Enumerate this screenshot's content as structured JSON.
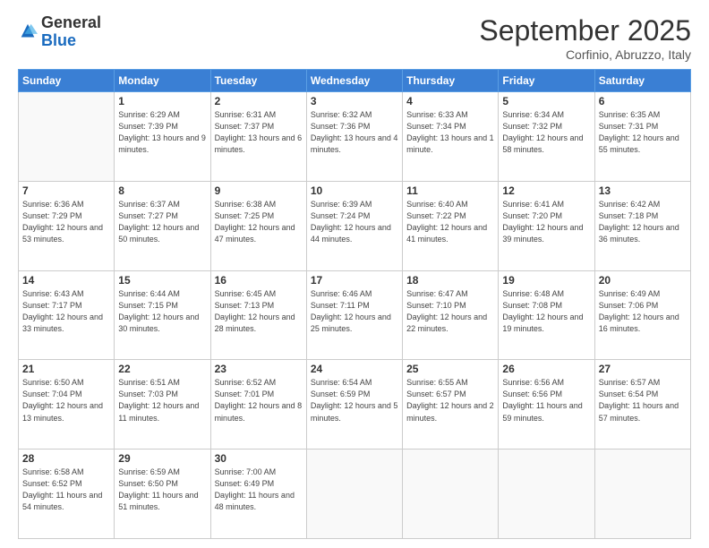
{
  "logo": {
    "general": "General",
    "blue": "Blue"
  },
  "title": "September 2025",
  "location": "Corfinio, Abruzzo, Italy",
  "days_of_week": [
    "Sunday",
    "Monday",
    "Tuesday",
    "Wednesday",
    "Thursday",
    "Friday",
    "Saturday"
  ],
  "weeks": [
    [
      {
        "day": "",
        "info": ""
      },
      {
        "day": "1",
        "info": "Sunrise: 6:29 AM\nSunset: 7:39 PM\nDaylight: 13 hours\nand 9 minutes."
      },
      {
        "day": "2",
        "info": "Sunrise: 6:31 AM\nSunset: 7:37 PM\nDaylight: 13 hours\nand 6 minutes."
      },
      {
        "day": "3",
        "info": "Sunrise: 6:32 AM\nSunset: 7:36 PM\nDaylight: 13 hours\nand 4 minutes."
      },
      {
        "day": "4",
        "info": "Sunrise: 6:33 AM\nSunset: 7:34 PM\nDaylight: 13 hours\nand 1 minute."
      },
      {
        "day": "5",
        "info": "Sunrise: 6:34 AM\nSunset: 7:32 PM\nDaylight: 12 hours\nand 58 minutes."
      },
      {
        "day": "6",
        "info": "Sunrise: 6:35 AM\nSunset: 7:31 PM\nDaylight: 12 hours\nand 55 minutes."
      }
    ],
    [
      {
        "day": "7",
        "info": "Sunrise: 6:36 AM\nSunset: 7:29 PM\nDaylight: 12 hours\nand 53 minutes."
      },
      {
        "day": "8",
        "info": "Sunrise: 6:37 AM\nSunset: 7:27 PM\nDaylight: 12 hours\nand 50 minutes."
      },
      {
        "day": "9",
        "info": "Sunrise: 6:38 AM\nSunset: 7:25 PM\nDaylight: 12 hours\nand 47 minutes."
      },
      {
        "day": "10",
        "info": "Sunrise: 6:39 AM\nSunset: 7:24 PM\nDaylight: 12 hours\nand 44 minutes."
      },
      {
        "day": "11",
        "info": "Sunrise: 6:40 AM\nSunset: 7:22 PM\nDaylight: 12 hours\nand 41 minutes."
      },
      {
        "day": "12",
        "info": "Sunrise: 6:41 AM\nSunset: 7:20 PM\nDaylight: 12 hours\nand 39 minutes."
      },
      {
        "day": "13",
        "info": "Sunrise: 6:42 AM\nSunset: 7:18 PM\nDaylight: 12 hours\nand 36 minutes."
      }
    ],
    [
      {
        "day": "14",
        "info": "Sunrise: 6:43 AM\nSunset: 7:17 PM\nDaylight: 12 hours\nand 33 minutes."
      },
      {
        "day": "15",
        "info": "Sunrise: 6:44 AM\nSunset: 7:15 PM\nDaylight: 12 hours\nand 30 minutes."
      },
      {
        "day": "16",
        "info": "Sunrise: 6:45 AM\nSunset: 7:13 PM\nDaylight: 12 hours\nand 28 minutes."
      },
      {
        "day": "17",
        "info": "Sunrise: 6:46 AM\nSunset: 7:11 PM\nDaylight: 12 hours\nand 25 minutes."
      },
      {
        "day": "18",
        "info": "Sunrise: 6:47 AM\nSunset: 7:10 PM\nDaylight: 12 hours\nand 22 minutes."
      },
      {
        "day": "19",
        "info": "Sunrise: 6:48 AM\nSunset: 7:08 PM\nDaylight: 12 hours\nand 19 minutes."
      },
      {
        "day": "20",
        "info": "Sunrise: 6:49 AM\nSunset: 7:06 PM\nDaylight: 12 hours\nand 16 minutes."
      }
    ],
    [
      {
        "day": "21",
        "info": "Sunrise: 6:50 AM\nSunset: 7:04 PM\nDaylight: 12 hours\nand 13 minutes."
      },
      {
        "day": "22",
        "info": "Sunrise: 6:51 AM\nSunset: 7:03 PM\nDaylight: 12 hours\nand 11 minutes."
      },
      {
        "day": "23",
        "info": "Sunrise: 6:52 AM\nSunset: 7:01 PM\nDaylight: 12 hours\nand 8 minutes."
      },
      {
        "day": "24",
        "info": "Sunrise: 6:54 AM\nSunset: 6:59 PM\nDaylight: 12 hours\nand 5 minutes."
      },
      {
        "day": "25",
        "info": "Sunrise: 6:55 AM\nSunset: 6:57 PM\nDaylight: 12 hours\nand 2 minutes."
      },
      {
        "day": "26",
        "info": "Sunrise: 6:56 AM\nSunset: 6:56 PM\nDaylight: 11 hours\nand 59 minutes."
      },
      {
        "day": "27",
        "info": "Sunrise: 6:57 AM\nSunset: 6:54 PM\nDaylight: 11 hours\nand 57 minutes."
      }
    ],
    [
      {
        "day": "28",
        "info": "Sunrise: 6:58 AM\nSunset: 6:52 PM\nDaylight: 11 hours\nand 54 minutes."
      },
      {
        "day": "29",
        "info": "Sunrise: 6:59 AM\nSunset: 6:50 PM\nDaylight: 11 hours\nand 51 minutes."
      },
      {
        "day": "30",
        "info": "Sunrise: 7:00 AM\nSunset: 6:49 PM\nDaylight: 11 hours\nand 48 minutes."
      },
      {
        "day": "",
        "info": ""
      },
      {
        "day": "",
        "info": ""
      },
      {
        "day": "",
        "info": ""
      },
      {
        "day": "",
        "info": ""
      }
    ]
  ]
}
